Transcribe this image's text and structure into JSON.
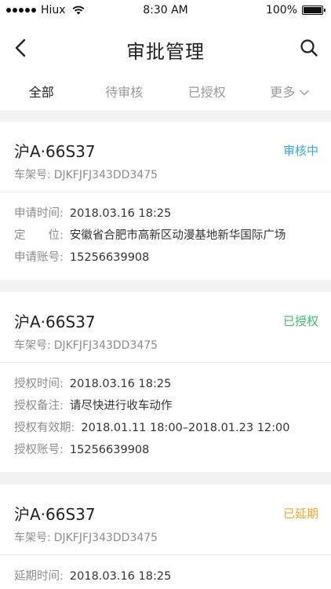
{
  "status_bar": {
    "carrier": "Hiux",
    "time": "8:30 AM",
    "battery": "100%",
    "battery_level": 1.0
  },
  "nav": {
    "title": "审批管理"
  },
  "tabs": [
    {
      "label": "全部",
      "active": true
    },
    {
      "label": "待审核",
      "active": false
    },
    {
      "label": "已授权",
      "active": false
    },
    {
      "label": "更多",
      "active": false
    }
  ],
  "colors": {
    "reviewing": "#3aa7e0",
    "authorized": "#3cbf6e",
    "extended": "#f5a623"
  },
  "cards": [
    {
      "plate": "沪A·66S37",
      "status": "审核中",
      "status_color": "#3aa7e0",
      "vin_label": "车架号:",
      "vin": "DJKFJFJ343DD3475",
      "rows": [
        {
          "label": "申请时间:",
          "value": "2018.03.16 18:25"
        },
        {
          "label": "定　　位:",
          "value": "安徽省合肥市高新区动漫基地新华国际广场"
        },
        {
          "label": "申请账号:",
          "value": "15256639908"
        }
      ]
    },
    {
      "plate": "沪A·66S37",
      "status": "已授权",
      "status_color": "#3cbf6e",
      "vin_label": "车架号:",
      "vin": "DJKFJFJ343DD3475",
      "rows": [
        {
          "label": "授权时间:",
          "value": "2018.03.16 18:25"
        },
        {
          "label": "授权备注:",
          "value": "请尽快进行收车动作"
        },
        {
          "label": "授权有效期:",
          "value": "2018.01.11 18:00–2018.01.23 12:00"
        },
        {
          "label": "授权账号:",
          "value": "15256639908"
        }
      ]
    },
    {
      "plate": "沪A·66S37",
      "status": "已延期",
      "status_color": "#f5a623",
      "vin_label": "车架号:",
      "vin": "DJKFJFJ343DD3475",
      "rows": [
        {
          "label": "延期时间:",
          "value": "2018.03.16 18:25"
        }
      ]
    }
  ]
}
